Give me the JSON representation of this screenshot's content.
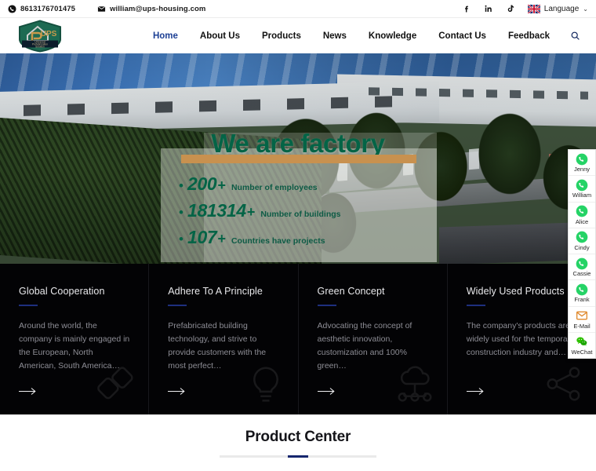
{
  "topbar": {
    "phone": "8613176701475",
    "phone_icon": "phone-icon",
    "email": "william@ups-housing.com",
    "email_icon": "envelope-icon",
    "social": [
      {
        "name": "facebook-icon",
        "label": "Facebook"
      },
      {
        "name": "linkedin-icon",
        "label": "LinkedIn"
      },
      {
        "name": "tiktok-icon",
        "label": "TikTok"
      }
    ],
    "language_label": "Language",
    "language_flag": "uk-flag-icon",
    "language_caret": "⌄"
  },
  "header": {
    "logo_text": "UPS",
    "logo_tagline_1": "Universal",
    "logo_tagline_2": "Prefabrication",
    "logo_tagline_3": "Solution",
    "nav": [
      {
        "label": "Home",
        "active": true
      },
      {
        "label": "About Us",
        "active": false
      },
      {
        "label": "Products",
        "active": false
      },
      {
        "label": "News",
        "active": false
      },
      {
        "label": "Knowledge",
        "active": false
      },
      {
        "label": "Contact Us",
        "active": false
      },
      {
        "label": "Feedback",
        "active": false
      }
    ],
    "search_icon": "search-icon"
  },
  "hero": {
    "title": "We are factory",
    "stats": [
      {
        "number": "200",
        "plus": "+",
        "label": "Number of employees"
      },
      {
        "number": "181314",
        "plus": "+",
        "label": "Number of buildings"
      },
      {
        "number": "107",
        "plus": "+",
        "label": "Countries have projects"
      }
    ],
    "accent_color": "#c8914f",
    "text_color": "#046446"
  },
  "contact_rail": [
    {
      "label": "Jenny",
      "icon": "whatsapp-icon"
    },
    {
      "label": "William",
      "icon": "whatsapp-icon"
    },
    {
      "label": "Alice",
      "icon": "whatsapp-icon"
    },
    {
      "label": "Cindy",
      "icon": "whatsapp-icon"
    },
    {
      "label": "Cassie",
      "icon": "whatsapp-icon"
    },
    {
      "label": "Frank",
      "icon": "whatsapp-icon"
    },
    {
      "label": "E-Mail",
      "icon": "email-icon"
    },
    {
      "label": "WeChat",
      "icon": "wechat-icon"
    }
  ],
  "features": [
    {
      "title": "Global Cooperation",
      "desc": "Around the world, the company is mainly engaged in the European, North American, South America…",
      "icon": "puzzle-icon",
      "arrow": "arrow-right-icon"
    },
    {
      "title": "Adhere To A Principle",
      "desc": "Prefabricated building technology, and strive to provide customers with the most perfect…",
      "icon": "lightbulb-icon",
      "arrow": "arrow-right-icon"
    },
    {
      "title": "Green Concept",
      "desc": "Advocating the concept of aesthetic innovation, customization and 100% green…",
      "icon": "cloud-network-icon",
      "arrow": "arrow-right-icon"
    },
    {
      "title": "Widely Used Products",
      "desc": "The company's products are widely used for the temporary construction industry and…",
      "icon": "share-nodes-icon",
      "arrow": "arrow-right-icon"
    }
  ],
  "product_section": {
    "title": "Product Center",
    "accent_color": "#15266e"
  }
}
